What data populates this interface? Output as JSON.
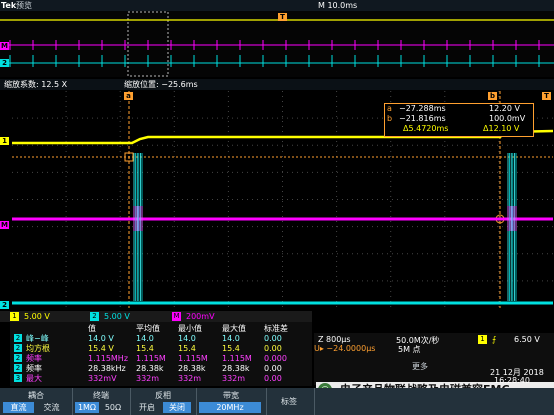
{
  "topbar": {
    "brand": "Tek",
    "mode": "预览",
    "timebase": "M 10.0ms"
  },
  "zoom_info": {
    "factor": "缩放系数: 12.5 X",
    "position": "缩放位置: −25.6ms"
  },
  "markers": {
    "trigger": "T",
    "cursor_a": "a",
    "cursor_b": "b",
    "ch1": "1",
    "ch2": "2",
    "math": "M"
  },
  "cursor_panel": {
    "a_time": "−27.288ms",
    "a_value": "12.20 V",
    "b_time": "−21.816ms",
    "b_value": "100.0mV",
    "delta_time": "Δ5.4720ms",
    "delta_value": "Δ12.10 V"
  },
  "channels": {
    "ch1_scale": "5.00 V",
    "ch2_scale": "5.00 V",
    "math_scale": "200mV"
  },
  "measurements": {
    "headers": [
      "值",
      "平均值",
      "最小值",
      "最大值",
      "标准差"
    ],
    "rows": [
      {
        "ch": "2",
        "label": "峰−峰",
        "values": [
          "14.0 V",
          "14.0",
          "14.0",
          "14.0",
          "0.00"
        ],
        "color": "#80ffff"
      },
      {
        "ch": "2",
        "label": "均方根",
        "values": [
          "15.4 V",
          "15.4",
          "15.4",
          "15.4",
          "0.00"
        ],
        "color": "#ffff40"
      },
      {
        "ch": "2",
        "label": "频率",
        "values": [
          "1.115MHz",
          "1.115M",
          "1.115M",
          "1.115M",
          "0.000"
        ],
        "color": "#ff40ff"
      },
      {
        "ch": "2",
        "label": "频率",
        "values": [
          "28.38kHz",
          "28.38k",
          "28.38k",
          "28.38k",
          "0.00"
        ],
        "color": "#ffffff"
      },
      {
        "ch": "3",
        "label": "最大",
        "values": [
          "332mV",
          "332m",
          "332m",
          "332m",
          "0.00"
        ],
        "color": "#ff40ff"
      }
    ]
  },
  "right_info": {
    "zoom_time": "Z 800μs",
    "offset": "U▸ −24.0000μs",
    "rate": "50.0M次/秒",
    "points": "5M 点",
    "trig_level": "6.50 V",
    "trig_ch": "1",
    "date": "21 12月 2018",
    "time": "16:28:40",
    "more": "更多"
  },
  "watermark": "电子产品物联战略及电磁兼容EMC",
  "menu": [
    {
      "title": "耦合",
      "options": [
        "直流",
        "交流"
      ],
      "selected": 0
    },
    {
      "title": "终端",
      "options": [
        "1MΩ",
        "50Ω"
      ],
      "selected": 0
    },
    {
      "title": "反相",
      "options": [
        "开启",
        "关闭"
      ],
      "selected": 1
    },
    {
      "title": "带宽",
      "options": [
        "20MHz"
      ],
      "selected": 0
    },
    {
      "title": "",
      "options": [
        "标签"
      ],
      "selected": -1
    }
  ],
  "colors": {
    "ch1": "#ffff00",
    "ch2": "#00e0e0",
    "math": "#ff00ff",
    "cursor": "#ffa030"
  }
}
